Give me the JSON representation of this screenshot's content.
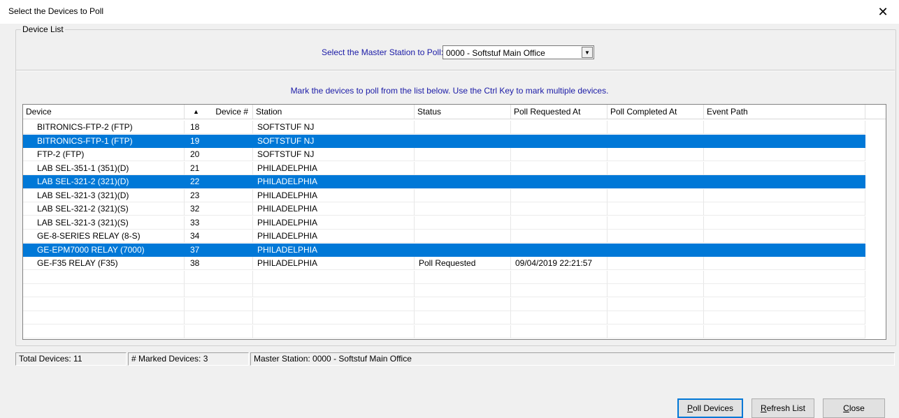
{
  "window": {
    "title": "Select the Devices to Poll",
    "close_glyph": "✕"
  },
  "group": {
    "label": "Device List"
  },
  "master_station": {
    "label": "Select the Master Station to Poll:",
    "selected": "0000 - Softstuf Main Office",
    "arrow_glyph": "▼"
  },
  "instructions": "Mark the devices to poll from the list below. Use the Ctrl Key to mark multiple devices.",
  "table": {
    "sort_glyph": "▲",
    "columns": [
      "Device",
      "Device #",
      "Station",
      "Status",
      "Poll Requested At",
      "Poll Completed At",
      "Event Path"
    ],
    "rows": [
      {
        "device": "BITRONICS-FTP-2 (FTP)",
        "num": "18",
        "station": "SOFTSTUF NJ",
        "status": "",
        "requested": "",
        "completed": "",
        "path": "",
        "selected": false
      },
      {
        "device": "BITRONICS-FTP-1 (FTP)",
        "num": "19",
        "station": "SOFTSTUF NJ",
        "status": "",
        "requested": "",
        "completed": "",
        "path": "",
        "selected": true
      },
      {
        "device": "FTP-2 (FTP)",
        "num": "20",
        "station": "SOFTSTUF NJ",
        "status": "",
        "requested": "",
        "completed": "",
        "path": "",
        "selected": false
      },
      {
        "device": "LAB SEL-351-1 (351)(D)",
        "num": "21",
        "station": "PHILADELPHIA",
        "status": "",
        "requested": "",
        "completed": "",
        "path": "",
        "selected": false
      },
      {
        "device": "LAB SEL-321-2 (321)(D)",
        "num": "22",
        "station": "PHILADELPHIA",
        "status": "",
        "requested": "",
        "completed": "",
        "path": "",
        "selected": true
      },
      {
        "device": "LAB SEL-321-3 (321)(D)",
        "num": "23",
        "station": "PHILADELPHIA",
        "status": "",
        "requested": "",
        "completed": "",
        "path": "",
        "selected": false
      },
      {
        "device": "LAB SEL-321-2 (321)(S)",
        "num": "32",
        "station": "PHILADELPHIA",
        "status": "",
        "requested": "",
        "completed": "",
        "path": "",
        "selected": false
      },
      {
        "device": "LAB SEL-321-3 (321)(S)",
        "num": "33",
        "station": "PHILADELPHIA",
        "status": "",
        "requested": "",
        "completed": "",
        "path": "",
        "selected": false
      },
      {
        "device": "GE-8-SERIES RELAY (8-S)",
        "num": "34",
        "station": "PHILADELPHIA",
        "status": "",
        "requested": "",
        "completed": "",
        "path": "",
        "selected": false
      },
      {
        "device": "GE-EPM7000 RELAY (7000)",
        "num": "37",
        "station": "PHILADELPHIA",
        "status": "",
        "requested": "",
        "completed": "",
        "path": "",
        "selected": true
      },
      {
        "device": "GE-F35 RELAY (F35)",
        "num": "38",
        "station": "PHILADELPHIA",
        "status": "Poll Requested",
        "requested": "09/04/2019 22:21:57",
        "completed": "",
        "path": "",
        "selected": false
      }
    ]
  },
  "statusbar": {
    "total": "Total Devices: 11",
    "marked": "# Marked Devices: 3",
    "master": "Master Station: 0000 - Softstuf Main Office"
  },
  "buttons": {
    "poll": {
      "key": "P",
      "rest": "oll Devices"
    },
    "refresh": {
      "key": "R",
      "rest": "efresh List"
    },
    "close": {
      "key": "C",
      "rest": "lose"
    }
  },
  "colors": {
    "selection": "#0078d7",
    "label_blue": "#1a1aa6"
  }
}
